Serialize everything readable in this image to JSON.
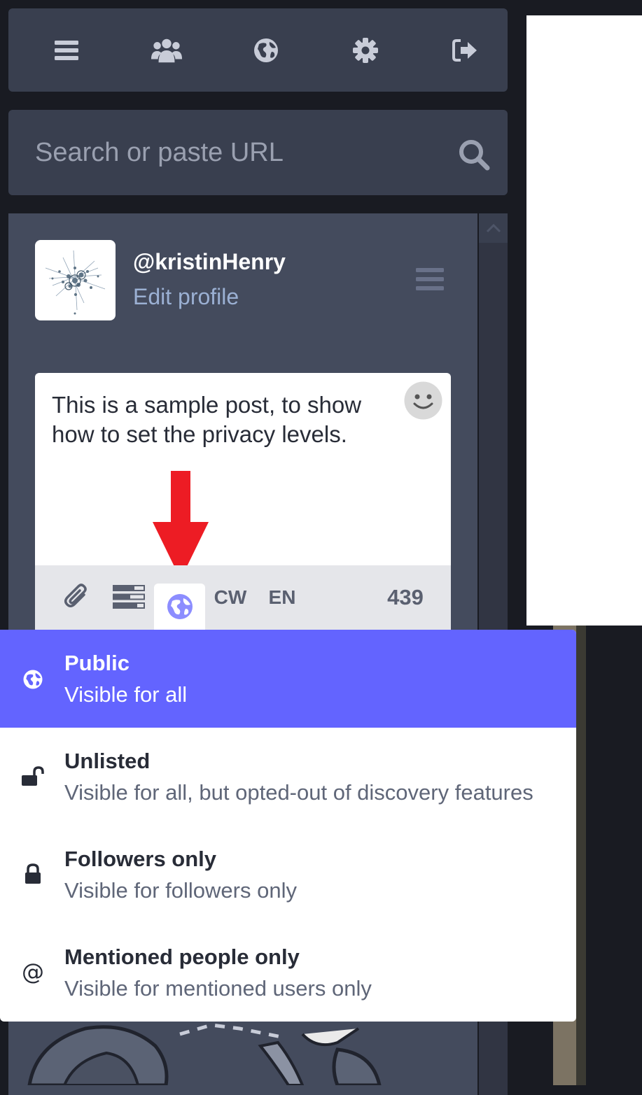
{
  "nav": {
    "items": [
      {
        "icon": "bars-icon",
        "label": "Menu"
      },
      {
        "icon": "users-icon",
        "label": "Local timeline"
      },
      {
        "icon": "globe-icon",
        "label": "Federated timeline"
      },
      {
        "icon": "gear-icon",
        "label": "Preferences"
      },
      {
        "icon": "sign-out-icon",
        "label": "Logout"
      }
    ]
  },
  "search": {
    "placeholder": "Search or paste URL",
    "icon": "search-icon"
  },
  "profile": {
    "username": "@kristinHenry",
    "edit_label": "Edit profile"
  },
  "compose": {
    "text": "This is a sample post, to show how to set the privacy levels.",
    "cw_label": "CW",
    "language_label": "EN",
    "char_count": "439",
    "accent_color": "#6364ff",
    "annotation_arrow_color": "#ed1c24"
  },
  "privacy": {
    "selected": "public",
    "options": [
      {
        "id": "public",
        "icon": "globe-icon",
        "title": "Public",
        "description": "Visible for all"
      },
      {
        "id": "unlisted",
        "icon": "unlock-icon",
        "title": "Unlisted",
        "description": "Visible for all, but opted-out of discovery features"
      },
      {
        "id": "private",
        "icon": "lock-icon",
        "title": "Followers only",
        "description": "Visible for followers only"
      },
      {
        "id": "direct",
        "icon": "at-icon",
        "title": "Mentioned people only",
        "description": "Visible for mentioned users only"
      }
    ]
  }
}
